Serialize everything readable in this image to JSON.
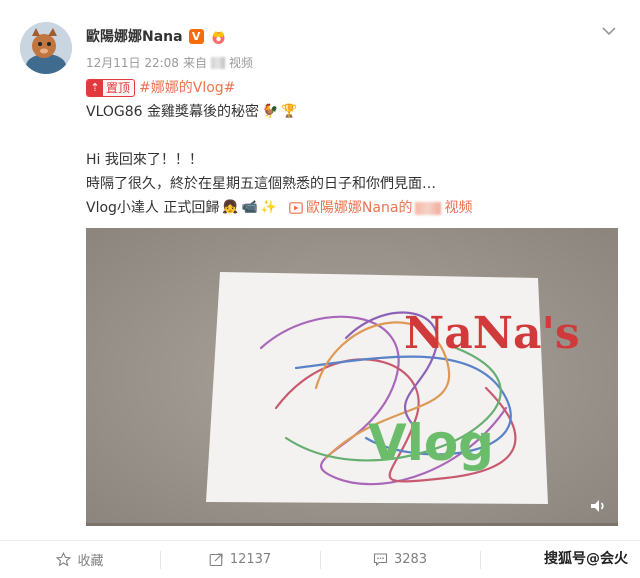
{
  "post": {
    "author": "歐陽娜娜Nana",
    "vip_badge": "V",
    "date": "12月11日 22:08",
    "from_label": "来自",
    "source": "视频",
    "pin_label": "置顶",
    "hashtag": "#娜娜的Vlog#",
    "title_line": "VLOG86 金雞獎幕後的秘密",
    "greeting": "Hi 我回來了！！！",
    "body_line": "時隔了很久，終於在星期五這個熟悉的日子和你們見面…",
    "closing": "Vlog小達人 正式回歸",
    "video_link_prefix": "歐陽娜娜Nana的",
    "video_link_suffix": "视频"
  },
  "video": {
    "paper_text_1": "NaNa's",
    "paper_text_2": "Vlog",
    "progress": 0.0
  },
  "actions": {
    "favorite": "收藏",
    "repost": "12137",
    "comments": "3283"
  },
  "watermark": {
    "text": "搜狐号@会火"
  },
  "icons": {
    "more": "chevron-down-icon",
    "pin": "pin-icon",
    "video_link": "play-video-icon",
    "volume": "volume-icon",
    "favorite": "star-icon",
    "repost": "repost-icon",
    "comment": "comment-icon"
  },
  "colors": {
    "link": "#eb7350",
    "pin": "#e4393c",
    "vip": "#f56c0c"
  }
}
